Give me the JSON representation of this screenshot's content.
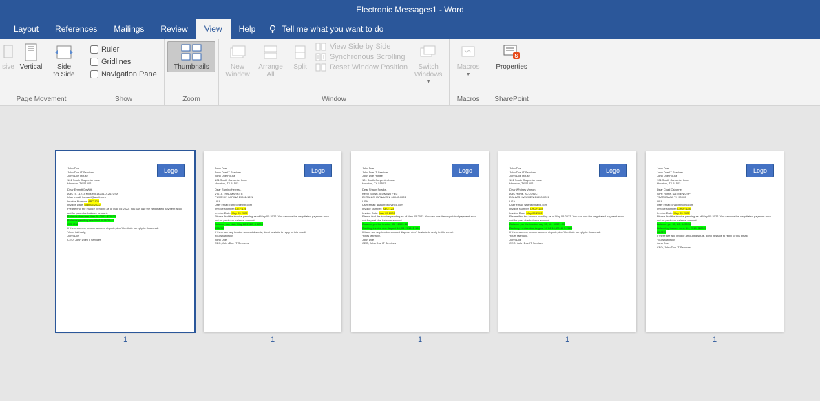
{
  "title": "Electronic Messages1  -  Word",
  "tabs": {
    "layout": "Layout",
    "references": "References",
    "mailings": "Mailings",
    "review": "Review",
    "view": "View",
    "help": "Help",
    "tellme": "Tell me what you want to do"
  },
  "ribbon": {
    "g1": {
      "sive": "sive",
      "vertical": "Vertical",
      "sidetoside": "Side\nto Side",
      "label": "Page Movement"
    },
    "g2": {
      "ruler": "Ruler",
      "gridlines": "Gridlines",
      "navpane": "Navigation Pane",
      "label": "Show"
    },
    "g3": {
      "thumbnails": "Thumbnails",
      "label": "Zoom"
    },
    "g4": {
      "newwindow": "New\nWindow",
      "arrangeall": "Arrange\nAll",
      "split": "Split",
      "sidebyside": "View Side by Side",
      "sync": "Synchronous Scrolling",
      "reset": "Reset Window Position",
      "switch": "Switch\nWindows",
      "label": "Window"
    },
    "g5": {
      "macros": "Macros",
      "label": "Macros"
    },
    "g6": {
      "properties": "Properties",
      "label": "SharePoint"
    }
  },
  "logo": "Logo",
  "pages": [
    {
      "num": "1",
      "header": [
        "John Doe",
        "John Doe IT Services",
        "John Doe House",
        "101 South Carpenter Lane",
        "Houston, TX 51502"
      ],
      "greet": "Dear Emmitt DeWitt,",
      "addr": [
        "ABC IT, 11213 Mills Rd 18234-0126, USA",
        "User email: bsmartt@abcit.com"
      ],
      "inv": "Invoice Number: ABC:123",
      "dt": "Invoice Date: May 05 2022",
      "body": "Please find the invoice pending as of May 05 2022. You can use the negotiated payment account for past-due balance amount.",
      "g1": "Balance due date May 28 2022: $ 2020",
      "g2": "Balance pending rate 05012018 20:43",
      "g3": "GGH232",
      "foot": [
        "If there are any invoice amount dispute, don't hesitate to reply to this email.",
        "Yours faithfully,",
        "John Doe",
        "CEO, John Doe IT Services"
      ]
    },
    {
      "num": "1",
      "header": [
        "John Doe",
        "John Doe IT Services",
        "John Doe House",
        "101 South Carpenter Lane",
        "Houston, TX 51502"
      ],
      "greet": "Dear Ramiro Herrera,",
      "addr": [
        "VISTA TRADMARKITE",
        "PUMPKIN LARINA 19002-122L",
        "USA",
        "User email: ramiro@epvb.com"
      ],
      "inv": "Invoice Number: DEF:128",
      "dt": "Invoice Date: May 05 2022",
      "body": "Please find the invoice pending as of May 05 2022. You can use the negotiated payment account for past-due balance amount.",
      "g1": "Balance due date May 28 2022: $ 4204",
      "g2": "456232",
      "g3": "",
      "foot": [
        "If there are any invoice amount dispute, don't hesitate to reply to this email.",
        "Yours faithfully,",
        "John Doe",
        "CEO, John Doe IT Services"
      ]
    },
    {
      "num": "1",
      "header": [
        "John Doe",
        "John Doe IT Services",
        "John Doe House",
        "101 South Carpenter Lane",
        "Houston, TX 51502"
      ],
      "greet": "Dear Shaun Sparks,",
      "addr": [
        "Kevin Brown, ICOMINO FBC",
        "BHRAN CHAPNAVON, 08042-0022",
        "USA",
        "User email: shaunf@kevinco.com"
      ],
      "inv": "Invoice Number: ABC:123",
      "dt": "Invoice Date: May 05 2022",
      "body": "Please find the invoice pending as of May 05 2022. You can use the negotiated payment account for past-due balance amount.",
      "g1": "Balance per the invoice 35, 12305.12",
      "g2": "Banking invoice due August 14, 04 2018: $ 180",
      "g3": "",
      "foot": [
        "If there are any invoice amount dispute, don't hesitate to reply to this email.",
        "Yours faithfully,",
        "John Doe",
        "CEO, John Doe IT Services"
      ]
    },
    {
      "num": "1",
      "header": [
        "John Doe",
        "John Doe IT Services",
        "John Doe House",
        "101 South Carpenter Lane",
        "Houston, TX 51502"
      ],
      "greet": "Dear Whitney Vinson,",
      "addr": [
        "ABC Home, ACCOINC",
        "DALLAS HWWHEN 24830-0226",
        "USA",
        "User email: whitney@abcl.com"
      ],
      "inv": "Invoice Number: LHOF:128",
      "dt": "Invoice Date: May 05 2022",
      "body": "Please find the invoice pending as of May 05 2022. You can use the negotiated payment account for past-due balance amount.",
      "g1": "Balance per the invoice day 35, 12: 50521.55",
      "g2": "Banking invoice due August 14 04 10, 2018: $ 2020",
      "g3": "",
      "foot": [
        "If there are any invoice amount dispute, don't hesitate to reply to this email.",
        "Yours faithfully,",
        "John Doe",
        "CEO, John Doe IT Services"
      ]
    },
    {
      "num": "1",
      "header": [
        "John Doe",
        "John Doe IT Services",
        "John Doe House",
        "101 South Carpenter Lane",
        "Houston, TX 51502"
      ],
      "greet": "Dear Chad Osborne,",
      "addr": [
        "GPR Home, NATMEN USP",
        "TEARKSANA TX 90000",
        "USA",
        "User email: chad@nccml.com"
      ],
      "inv": "Invoice Number: LHOF:128",
      "dt": "Invoice Date: May 05 2022",
      "body": "Please find the invoice pending as of May 05 2022. You can use the negotiated payment account for past-due balance amount.",
      "g1": "Balance per 35, 12: 3435.12",
      "g2": "Balancing invoice June 10, 2018: $ 2020",
      "g3": "OL0220",
      "foot": [
        "If there are any invoice amount dispute, don't hesitate to reply to this email.",
        "Yours faithfully,",
        "John Doe",
        "CEO, John Doe IT Services"
      ]
    }
  ]
}
